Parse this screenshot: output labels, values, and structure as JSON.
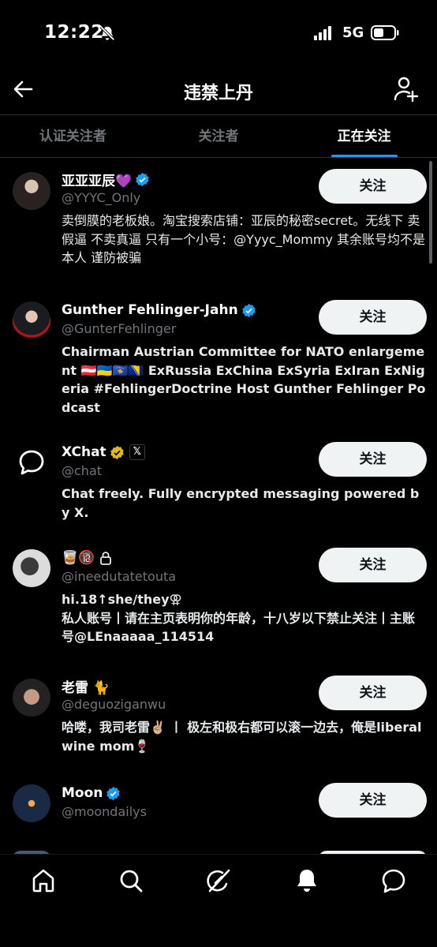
{
  "status_bar": {
    "time": "12:22",
    "network": "5G"
  },
  "header": {
    "title": "违禁上丹"
  },
  "tabs": [
    {
      "label": "认证关注者",
      "active": false
    },
    {
      "label": "关注者",
      "active": false
    },
    {
      "label": "正在关注",
      "active": true
    }
  ],
  "users": [
    {
      "name": "亚亚亚辰💜",
      "handle": "@YYYC_Only",
      "verified": "blue",
      "bio": "卖倒膜的老板娘。淘宝搜索店铺：亚辰的秘密secret。无线下 卖假逼 不卖真逼 只有一个小号：@Yyyc_Mommy 其余账号均不是本人 谨防被骗",
      "follow_label": "关注"
    },
    {
      "name": "Gunther Fehlinger-Jahn",
      "handle": "@GunterFehlinger",
      "verified": "blue",
      "bio": "Chairman Austrian Committee for NATO enlargement 🇦🇹🇺🇦🇽🇰🇧🇦 ExRussia ExChina ExSyria ExIran ExNigeria #FehlingerDoctrine Host Gunther Fehlinger Podcast",
      "follow_label": "关注"
    },
    {
      "name": "XChat",
      "handle": "@chat",
      "verified": "gold",
      "affiliate": "𝕏",
      "bio": "Chat freely. Fully encrypted messaging powered by X.",
      "follow_label": "关注"
    },
    {
      "name": "🥃🔞",
      "handle": "@ineedutatetouta",
      "locked": true,
      "bio": "hi.18↑she/they⚢\n私人账号丨请在主页表明你的年龄，十八岁以下禁止关注丨主账号@LEnaaaaa_114514",
      "follow_label": "关注"
    },
    {
      "name": "老雷 🐈",
      "handle": "@deguoziganwu",
      "bio": "哈喽，我司老雷✌🏼 丨 极左和极右都可以滚一边去，俺是liberal wine mom🍷",
      "follow_label": "关注"
    },
    {
      "name": "Moon",
      "handle": "@moondailys",
      "verified": "blue",
      "bio": "",
      "follow_label": "关注"
    }
  ],
  "colors": {
    "accent": "#1d9bf0",
    "gold": "#e2b719",
    "button_bg": "#eff3f4",
    "secondary_text": "#71767b"
  },
  "nav": [
    "home-icon",
    "search-icon",
    "grok-icon",
    "notifications-icon",
    "messages-icon"
  ]
}
